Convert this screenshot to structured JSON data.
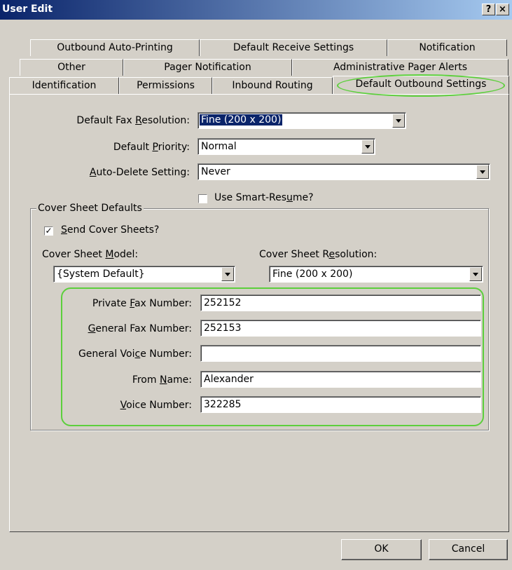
{
  "window": {
    "title": "User Edit",
    "help_label": "?",
    "close_label": "×"
  },
  "tabs": {
    "row1": [
      "Outbound Auto-Printing",
      "Default Receive Settings",
      "Notification"
    ],
    "row2": [
      "Other",
      "Pager Notification",
      "Administrative Pager Alerts"
    ],
    "row3": [
      "Identification",
      "Permissions",
      "Inbound Routing",
      "Default Outbound Settings"
    ],
    "selected": "Default Outbound Settings"
  },
  "form": {
    "resolution_label": "Default Fax Resolution:",
    "resolution_value": "Fine (200 x 200)",
    "priority_label": "Default Priority:",
    "priority_value": "Normal",
    "autodelete_label": "Auto-Delete Setting:",
    "autodelete_value": "Never",
    "smart_resume_label": "Use Smart-Resume?",
    "smart_resume_checked": false
  },
  "cover": {
    "group_label": "Cover Sheet Defaults",
    "send_label": "Send Cover Sheets?",
    "send_checked": true,
    "check_mark": "✓",
    "model_label": "Cover Sheet Model:",
    "model_value": "{System Default}",
    "res_label": "Cover Sheet Resolution:",
    "res_value": "Fine (200 x 200)"
  },
  "numbers": {
    "private_fax_label": "Private Fax Number:",
    "private_fax_value": "252152",
    "general_fax_label": "General Fax Number:",
    "general_fax_value": "252153",
    "general_voice_label": "General Voice Number:",
    "general_voice_value": "",
    "from_name_label": "From Name:",
    "from_name_value": "Alexander",
    "voice_label": "Voice Number:",
    "voice_value": "322285"
  },
  "buttons": {
    "ok": "OK",
    "cancel": "Cancel"
  },
  "colors": {
    "titlebar": "#0a246a",
    "face": "#d4d0c8",
    "selection": "#0a246a",
    "annotation": "#5ccf3c"
  }
}
